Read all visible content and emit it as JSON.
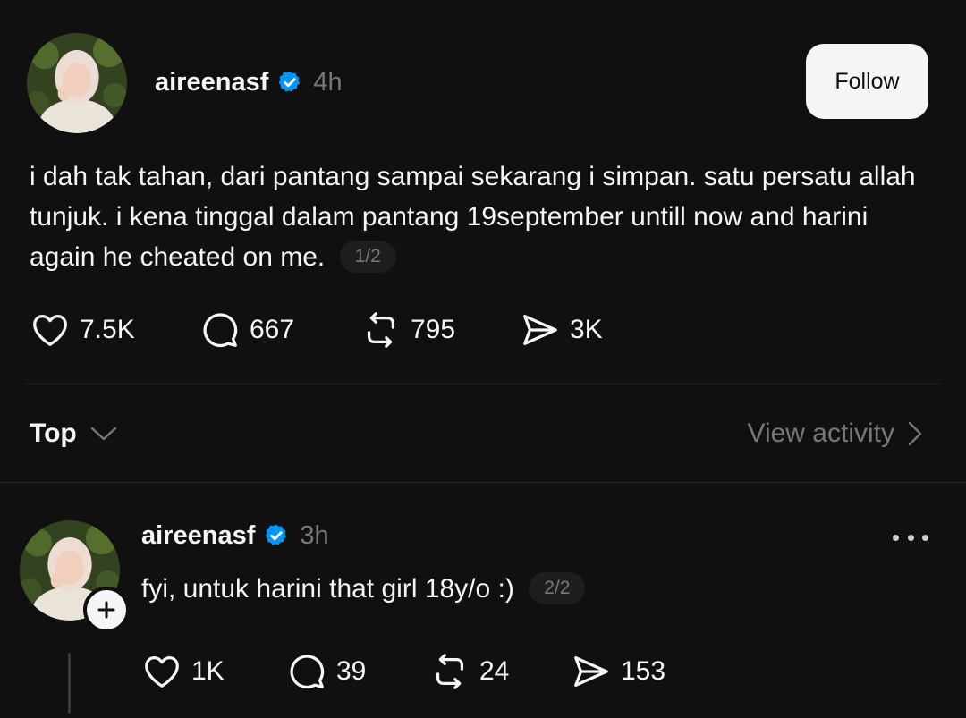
{
  "post": {
    "username": "aireenasf",
    "time": "4h",
    "follow_label": "Follow",
    "text": "i dah tak tahan, dari pantang sampai sekarang i simpan. satu persatu allah tunjuk. i kena tinggal dalam pantang 19september untill now and harini again he cheated on me.",
    "page_indicator": "1/2",
    "stats": {
      "likes": "7.5K",
      "comments": "667",
      "reposts": "795",
      "shares": "3K"
    }
  },
  "sort": {
    "label": "Top",
    "activity_label": "View activity"
  },
  "reply": {
    "username": "aireenasf",
    "time": "3h",
    "text": "fyi, untuk harini that girl 18y/o :)",
    "page_indicator": "2/2",
    "stats": {
      "likes": "1K",
      "comments": "39",
      "reposts": "24",
      "shares": "153"
    }
  },
  "icons": {
    "like": "heart-icon",
    "comment": "comment-bubble-icon",
    "repost": "repost-icon",
    "share": "send-icon",
    "verified": "verified-badge-icon",
    "more": "more-dots-icon",
    "plus": "plus-icon",
    "chevron_down": "chevron-down-icon",
    "chevron_right": "chevron-right-icon"
  },
  "colors": {
    "background": "#101010",
    "text": "#f3f5f7",
    "muted": "#777777",
    "verified": "#0095f6"
  }
}
